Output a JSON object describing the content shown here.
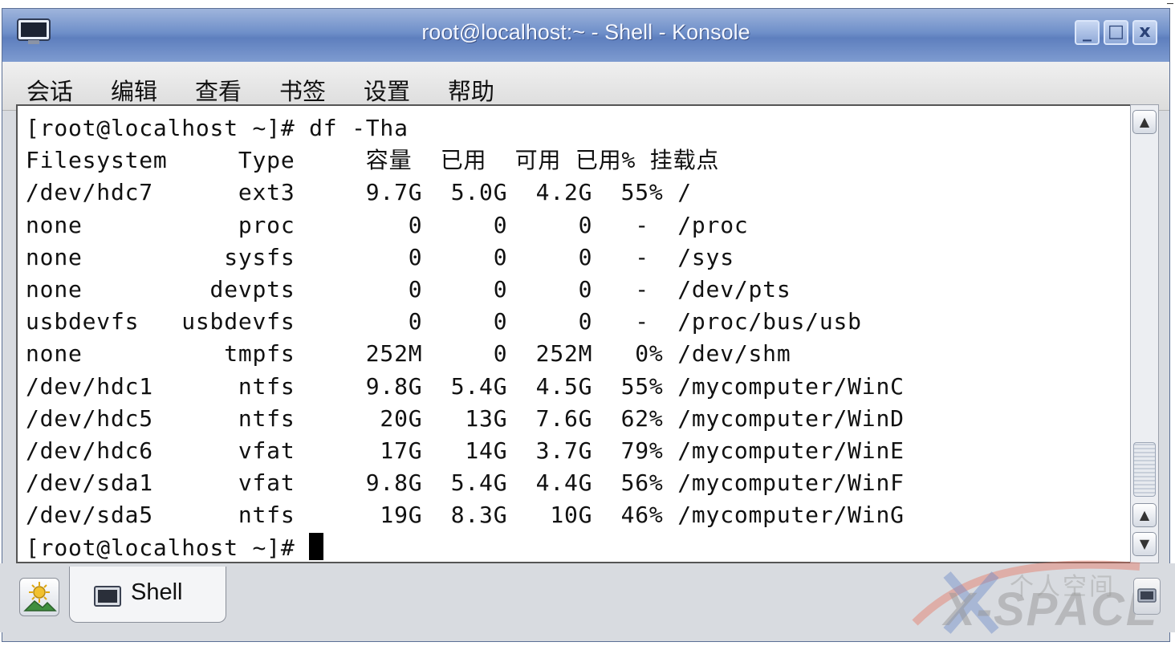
{
  "window": {
    "title": "root@localhost:~ - Shell - Konsole",
    "buttons": {
      "minimize": "_",
      "maximize": "□",
      "close": "x"
    },
    "colors": {
      "titlebar": "#6f8fc9",
      "terminal_bg": "#ffffff",
      "text": "#111111"
    }
  },
  "menubar": {
    "items": [
      "会话",
      "编辑",
      "查看",
      "书签",
      "设置",
      "帮助"
    ]
  },
  "terminal": {
    "lines": [
      "[root@localhost ~]# df -Tha",
      "Filesystem     Type     容量  已用  可用 已用% 挂载点",
      "/dev/hdc7      ext3     9.7G  5.0G  4.2G  55% /",
      "none           proc        0     0     0   -  /proc",
      "none          sysfs        0     0     0   -  /sys",
      "none         devpts        0     0     0   -  /dev/pts",
      "usbdevfs   usbdevfs        0     0     0   -  /proc/bus/usb",
      "none          tmpfs     252M     0  252M   0% /dev/shm",
      "/dev/hdc1      ntfs     9.8G  5.4G  4.5G  55% /mycomputer/WinC",
      "/dev/hdc5      ntfs      20G   13G  7.6G  62% /mycomputer/WinD",
      "/dev/hdc6      vfat      17G   14G  3.7G  79% /mycomputer/WinE",
      "/dev/sda1      vfat     9.8G  5.4G  4.4G  56% /mycomputer/WinF",
      "/dev/sda5      ntfs      19G  8.3G   10G  46% /mycomputer/WinG"
    ],
    "prompt": "[root@localhost ~]# "
  },
  "tabbar": {
    "tabs": [
      {
        "label": "Shell",
        "icon": "terminal-icon"
      }
    ],
    "new_session_icon": "new-session-icon",
    "close_icon": "close-session-icon"
  },
  "watermark": {
    "text": "个人空间",
    "brand": "X-SPACE"
  }
}
